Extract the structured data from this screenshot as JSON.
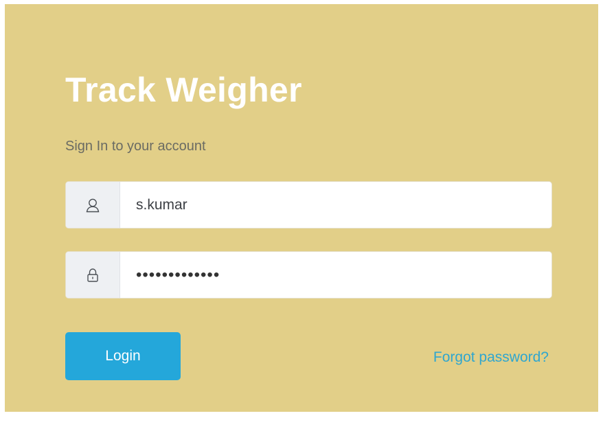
{
  "login": {
    "title": "Track Weigher",
    "subtitle": "Sign In to your account",
    "username_value": "s.kumar",
    "password_value": "•••••••••••••",
    "login_label": "Login",
    "forgot_label": "Forgot password?"
  },
  "icons": {
    "username": "user-icon",
    "password": "lock-icon"
  },
  "colors": {
    "card_background": "#e2cf88",
    "title": "#ffffff",
    "subtitle": "#6a6b63",
    "button": "#24a7da",
    "link": "#2fa6cf",
    "addon_background": "#eef0f3"
  }
}
